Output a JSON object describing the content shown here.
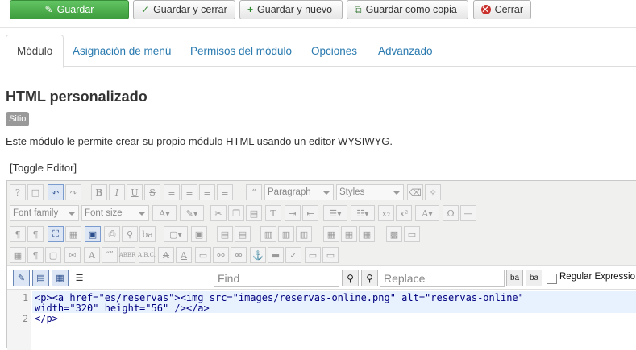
{
  "toolbar": {
    "save": "Guardar",
    "save_close": "Guardar y cerrar",
    "save_new": "Guardar y nuevo",
    "save_copy": "Guardar como copia",
    "close": "Cerrar"
  },
  "tabs": [
    "Módulo",
    "Asignación de menú",
    "Permisos del módulo",
    "Opciones",
    "Advanzado"
  ],
  "page": {
    "title": "HTML personalizado",
    "badge": "Sitio",
    "description": "Este módulo le permite crear su propio módulo HTML usando un editor WYSIWYG.",
    "toggle_editor": "[Toggle Editor]"
  },
  "editor": {
    "format_select": "Paragraph",
    "styles_select": "Styles",
    "font_family_select": "Font family",
    "font_size_select": "Font size",
    "find_placeholder": "Find",
    "replace_placeholder": "Replace",
    "regex_label": "Regular Expressio",
    "code_lines": [
      "<p><a href=\"es/reservas\"><img src=\"images/reservas-online.png\" alt=\"reservas-online\"",
      "width=\"320\" height=\"56\" /></a>",
      "</p>"
    ],
    "line_numbers": [
      "1",
      "2"
    ]
  }
}
